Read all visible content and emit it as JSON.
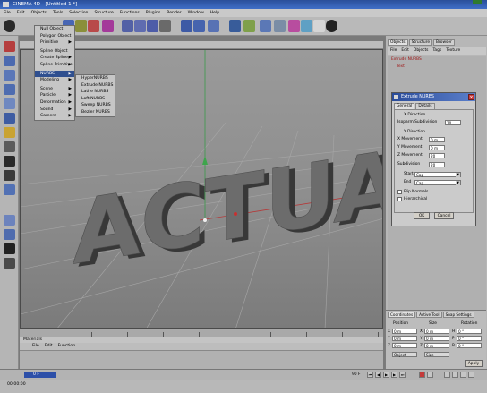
{
  "window": {
    "title": "CINEMA 4D - [Untitled 1 *]"
  },
  "menubar": [
    "File",
    "Edit",
    "Objects",
    "Tools",
    "Selection",
    "Structure",
    "Functions",
    "Plugins",
    "Render",
    "Window",
    "Help"
  ],
  "viewport": {
    "menu_label": "View",
    "text_3d": "ACTUAL"
  },
  "objects_menu": {
    "items": [
      "Null Object",
      "Polygon Object",
      "Primitive",
      "Spline Object",
      "Create Spline",
      "Spline Primitive",
      "NURBS",
      "Modeling",
      "Scene",
      "Particle",
      "Deformation",
      "Sound",
      "Camera"
    ],
    "arrow": "▶"
  },
  "nurbs_submenu": {
    "items": [
      "HyperNURBS",
      "Extrude NURBS",
      "Lathe NURBS",
      "Loft NURBS",
      "Sweep NURBS",
      "Bezier NURBS"
    ]
  },
  "object_manager": {
    "tabs": [
      "Objects",
      "Structure",
      "Browser"
    ],
    "menu": [
      "File",
      "Edit",
      "Objects",
      "Tags",
      "Texture"
    ],
    "objects": [
      "Extrude NURBS",
      "Text"
    ]
  },
  "dialog": {
    "title": "Extrude NURBS",
    "tabs": [
      "General",
      "Details"
    ],
    "x_direction_label": "X Direction",
    "isoparm_label": "Isoparm Subdivision",
    "isoparm_value": "10",
    "y_direction_label": "Y Direction",
    "x_move_label": "X Movement",
    "x_move_value": "0 m",
    "y_move_label": "Y Movement",
    "y_move_value": "0 m",
    "z_move_label": "Z Movement",
    "z_move_value": "20",
    "subdivision_label": "Subdivision",
    "subdivision_value": "20",
    "start_label": "Start",
    "start_value": "Cap",
    "end_label": "End",
    "end_value": "Cap",
    "flip_normals": "Flip Normals",
    "hierarchical": "Hierarchical",
    "ok": "OK",
    "cancel": "Cancel"
  },
  "coordinates": {
    "tabs": [
      "Coordinates",
      "Active Tool",
      "Snap Settings"
    ],
    "headers": [
      "Position",
      "Size",
      "Rotation"
    ],
    "rows": [
      {
        "axis": "X",
        "pos": "0 m",
        "size_axis": "X",
        "size": "0 m",
        "rot_axis": "H",
        "rot": "0 °"
      },
      {
        "axis": "Y",
        "pos": "0 m",
        "size_axis": "Y",
        "size": "0 m",
        "rot_axis": "P",
        "rot": "0 °"
      },
      {
        "axis": "Z",
        "pos": "0 m",
        "size_axis": "Z",
        "size": "0 m",
        "rot_axis": "B",
        "rot": "0 °"
      }
    ],
    "mode_object": "Object",
    "mode_size": "Size",
    "apply": "Apply"
  },
  "lower_manager": {
    "title": "Materials",
    "menu": [
      "File",
      "Edit",
      "Function"
    ]
  },
  "statusbar": {
    "frame": "0 F",
    "end_frame": "90 F"
  },
  "bottom": {
    "status": "00:00:00"
  }
}
